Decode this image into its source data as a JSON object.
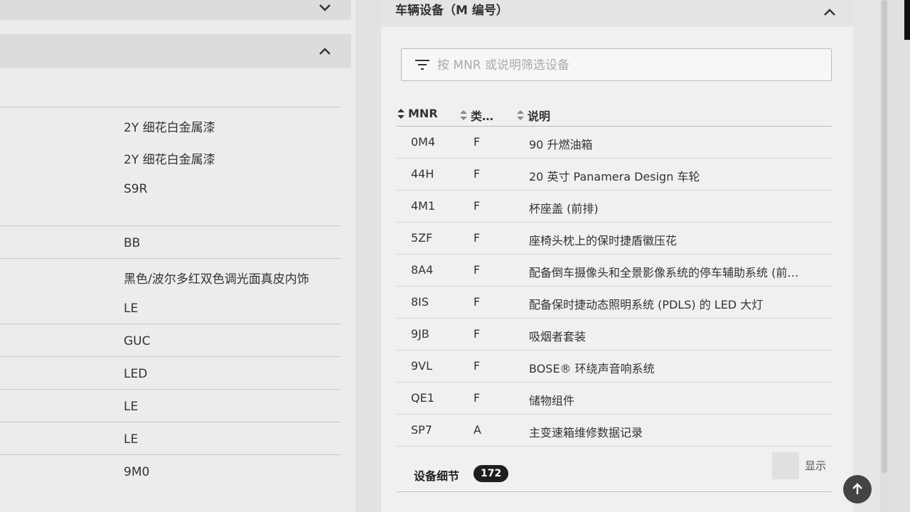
{
  "right_panel": {
    "title": "车辆设备（M 编号）",
    "filter_placeholder": "按 MNR 或说明筛选设备",
    "columns": [
      "MNR",
      "类…",
      "说明"
    ],
    "rows": [
      {
        "mnr": "0M4",
        "type": "F",
        "desc": "90 升燃油箱"
      },
      {
        "mnr": "44H",
        "type": "F",
        "desc": "20 英寸 Panamera Design 车轮"
      },
      {
        "mnr": "4M1",
        "type": "F",
        "desc": "杯座盖 (前排)"
      },
      {
        "mnr": "5ZF",
        "type": "F",
        "desc": "座椅头枕上的保时捷盾徽压花"
      },
      {
        "mnr": "8A4",
        "type": "F",
        "desc": "配备倒车摄像头和全景影像系统的停车辅助系统 (前…"
      },
      {
        "mnr": "8IS",
        "type": "F",
        "desc": "配备保时捷动态照明系统 (PDLS) 的 LED 大灯"
      },
      {
        "mnr": "9JB",
        "type": "F",
        "desc": "吸烟者套装"
      },
      {
        "mnr": "9VL",
        "type": "F",
        "desc": "BOSE® 环绕声音响系统"
      },
      {
        "mnr": "QE1",
        "type": "F",
        "desc": "储物组件"
      },
      {
        "mnr": "SP7",
        "type": "A",
        "desc": "主变速箱维修数据记录"
      }
    ],
    "details_label": "设备细节",
    "details_count": "172",
    "show_label": "显示"
  },
  "left_panel": {
    "values": [
      "2Y 细花白金属漆",
      "2Y 细花白金属漆",
      "S9R",
      "",
      "BB",
      "黑色/波尔多红双色调光面真皮内饰",
      "LE",
      "GUC",
      "LED",
      "LE",
      "LE",
      "9M0"
    ]
  },
  "colors": {
    "badge_bg": "#1e1e1e",
    "scroll_top_button": "#444444"
  }
}
